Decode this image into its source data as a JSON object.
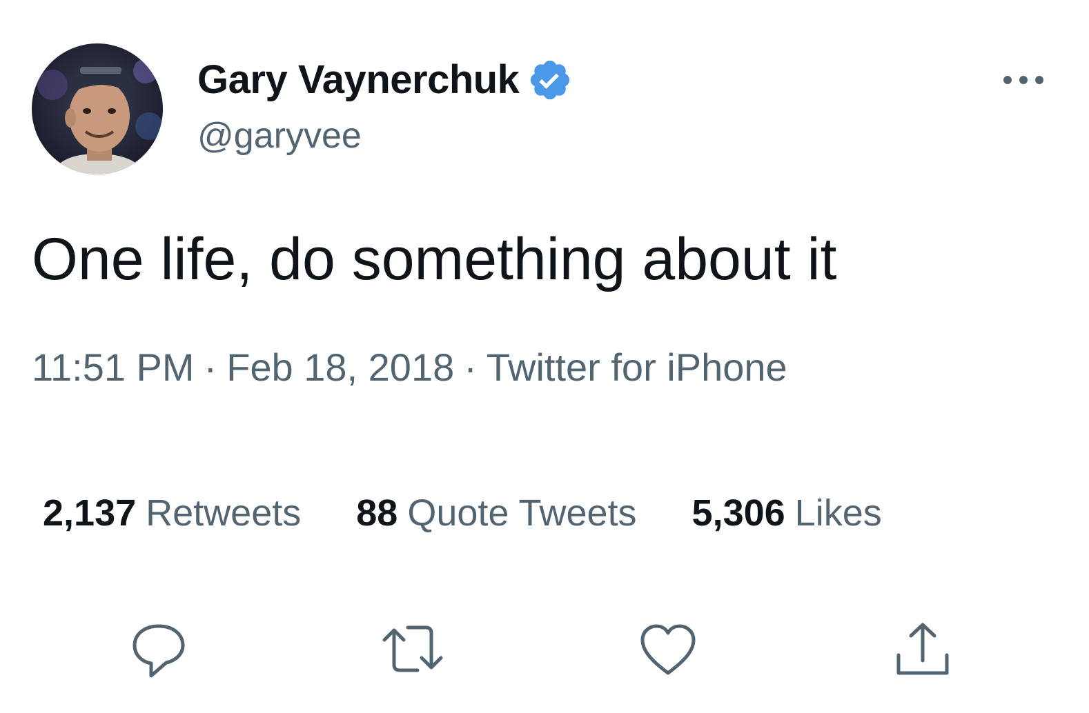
{
  "author": {
    "display_name": "Gary Vaynerchuk",
    "handle": "@garyvee",
    "verified": true,
    "verified_color": "#4a99e9"
  },
  "tweet": {
    "text": "One life, do something about it",
    "time": "11:51 PM",
    "separator": "·",
    "date": "Feb 18, 2018",
    "source": "Twitter for iPhone"
  },
  "stats": {
    "retweets": {
      "count": "2,137",
      "label": "Retweets"
    },
    "quotes": {
      "count": "88",
      "label": "Quote Tweets"
    },
    "likes": {
      "count": "5,306",
      "label": "Likes"
    }
  },
  "actions": [
    {
      "icon": "reply-icon"
    },
    {
      "icon": "retweet-icon"
    },
    {
      "icon": "like-icon"
    },
    {
      "icon": "share-icon"
    }
  ],
  "colors": {
    "primary_text": "#0f1419",
    "secondary_text": "#536471",
    "icon": "#536471"
  }
}
